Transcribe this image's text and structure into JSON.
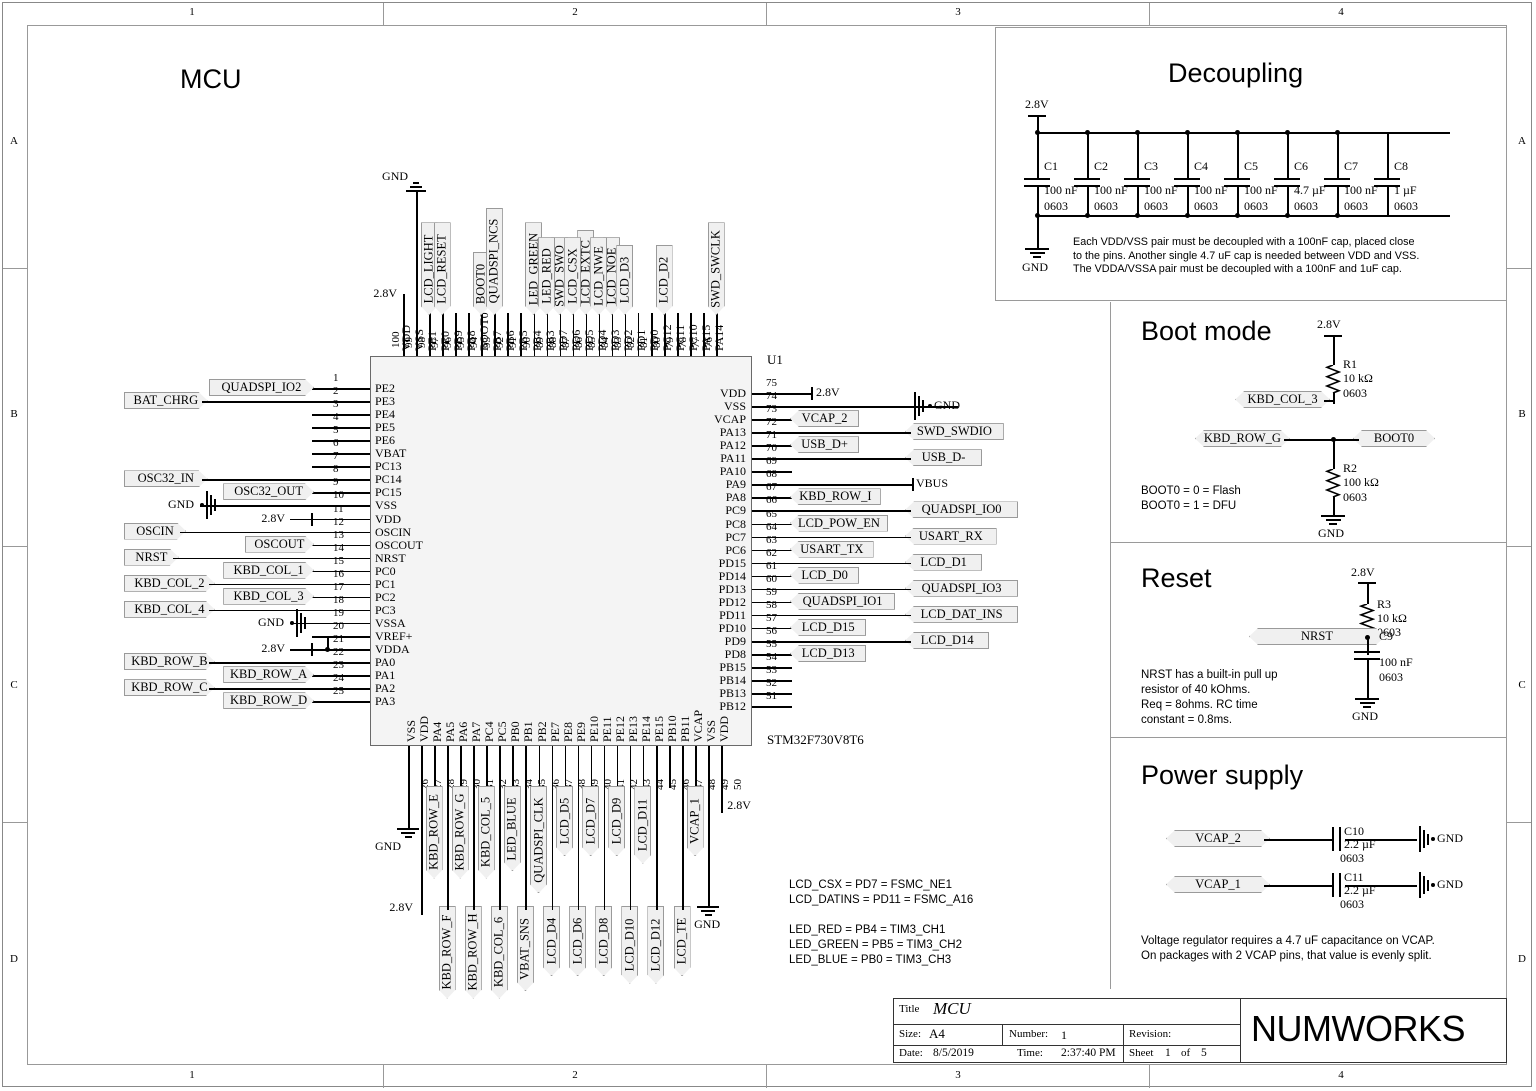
{
  "sheet": {
    "zones_top": [
      "1",
      "2",
      "3",
      "4"
    ],
    "zones_bottom": [
      "1",
      "2",
      "3",
      "4"
    ],
    "zones_left": [
      "A",
      "B",
      "C",
      "D"
    ],
    "zones_right": [
      "A",
      "B",
      "C",
      "D"
    ]
  },
  "titles": {
    "mcu": "MCU",
    "decoupling": "Decoupling",
    "boot_mode": "Boot mode",
    "reset": "Reset",
    "power_supply": "Power supply"
  },
  "chip": {
    "refdes": "U1",
    "part_number": "STM32F730V8T6",
    "left_pins": [
      {
        "num": "1",
        "name": "PE2"
      },
      {
        "num": "2",
        "name": "PE3"
      },
      {
        "num": "3",
        "name": "PE4"
      },
      {
        "num": "4",
        "name": "PE5"
      },
      {
        "num": "5",
        "name": "PE6"
      },
      {
        "num": "6",
        "name": "VBAT"
      },
      {
        "num": "7",
        "name": "PC13"
      },
      {
        "num": "8",
        "name": "PC14"
      },
      {
        "num": "9",
        "name": "PC15"
      },
      {
        "num": "10",
        "name": "VSS"
      },
      {
        "num": "11",
        "name": "VDD"
      },
      {
        "num": "12",
        "name": "OSCIN"
      },
      {
        "num": "13",
        "name": "OSCOUT"
      },
      {
        "num": "14",
        "name": "NRST"
      },
      {
        "num": "15",
        "name": "PC0"
      },
      {
        "num": "16",
        "name": "PC1"
      },
      {
        "num": "17",
        "name": "PC2"
      },
      {
        "num": "18",
        "name": "PC3"
      },
      {
        "num": "19",
        "name": "VSSA"
      },
      {
        "num": "20",
        "name": "VREF+"
      },
      {
        "num": "21",
        "name": "VDDA"
      },
      {
        "num": "22",
        "name": "PA0"
      },
      {
        "num": "23",
        "name": "PA1"
      },
      {
        "num": "24",
        "name": "PA2"
      },
      {
        "num": "25",
        "name": "PA3"
      }
    ],
    "bottom_pins": [
      {
        "num": "26",
        "name": "VSS"
      },
      {
        "num": "27",
        "name": "VDD"
      },
      {
        "num": "28",
        "name": "PA4"
      },
      {
        "num": "29",
        "name": "PA5"
      },
      {
        "num": "30",
        "name": "PA6"
      },
      {
        "num": "31",
        "name": "PA7"
      },
      {
        "num": "32",
        "name": "PC4"
      },
      {
        "num": "33",
        "name": "PC5"
      },
      {
        "num": "34",
        "name": "PB0"
      },
      {
        "num": "35",
        "name": "PB1"
      },
      {
        "num": "36",
        "name": "PB2"
      },
      {
        "num": "37",
        "name": "PE7"
      },
      {
        "num": "38",
        "name": "PE8"
      },
      {
        "num": "39",
        "name": "PE9"
      },
      {
        "num": "40",
        "name": "PE10"
      },
      {
        "num": "41",
        "name": "PE11"
      },
      {
        "num": "42",
        "name": "PE12"
      },
      {
        "num": "43",
        "name": "PE13"
      },
      {
        "num": "44",
        "name": "PE14"
      },
      {
        "num": "45",
        "name": "PE15"
      },
      {
        "num": "46",
        "name": "PB10"
      },
      {
        "num": "47",
        "name": "PB11"
      },
      {
        "num": "48",
        "name": "VCAP"
      },
      {
        "num": "49",
        "name": "VSS"
      },
      {
        "num": "50",
        "name": "VDD"
      }
    ],
    "right_pins": [
      {
        "num": "75",
        "name": "VDD"
      },
      {
        "num": "74",
        "name": "VSS"
      },
      {
        "num": "73",
        "name": "VCAP"
      },
      {
        "num": "72",
        "name": "PA13"
      },
      {
        "num": "71",
        "name": "PA12"
      },
      {
        "num": "70",
        "name": "PA11"
      },
      {
        "num": "69",
        "name": "PA10"
      },
      {
        "num": "68",
        "name": "PA9"
      },
      {
        "num": "67",
        "name": "PA8"
      },
      {
        "num": "66",
        "name": "PC9"
      },
      {
        "num": "65",
        "name": "PC8"
      },
      {
        "num": "64",
        "name": "PC7"
      },
      {
        "num": "63",
        "name": "PC6"
      },
      {
        "num": "62",
        "name": "PD15"
      },
      {
        "num": "61",
        "name": "PD14"
      },
      {
        "num": "60",
        "name": "PD13"
      },
      {
        "num": "59",
        "name": "PD12"
      },
      {
        "num": "58",
        "name": "PD11"
      },
      {
        "num": "57",
        "name": "PD10"
      },
      {
        "num": "56",
        "name": "PD9"
      },
      {
        "num": "55",
        "name": "PD8"
      },
      {
        "num": "54",
        "name": "PB15"
      },
      {
        "num": "53",
        "name": "PB14"
      },
      {
        "num": "52",
        "name": "PB13"
      },
      {
        "num": "51",
        "name": "PB12"
      }
    ],
    "top_pins": [
      {
        "num": "100",
        "name": "VDD"
      },
      {
        "num": "99",
        "name": "VSS"
      },
      {
        "num": "98",
        "name": "PE1"
      },
      {
        "num": "97",
        "name": "PE0"
      },
      {
        "num": "96",
        "name": "PB9"
      },
      {
        "num": "95",
        "name": "PB8"
      },
      {
        "num": "94",
        "name": "BOOT0"
      },
      {
        "num": "93",
        "name": "PB7"
      },
      {
        "num": "92",
        "name": "PB6"
      },
      {
        "num": "91",
        "name": "PB5"
      },
      {
        "num": "90",
        "name": "PB4"
      },
      {
        "num": "89",
        "name": "PB3"
      },
      {
        "num": "88",
        "name": "PD7"
      },
      {
        "num": "87",
        "name": "PD6"
      },
      {
        "num": "86",
        "name": "PD5"
      },
      {
        "num": "85",
        "name": "PD4"
      },
      {
        "num": "84",
        "name": "PD3"
      },
      {
        "num": "83",
        "name": "PD2"
      },
      {
        "num": "82",
        "name": "PD1"
      },
      {
        "num": "81",
        "name": "PD0"
      },
      {
        "num": "80",
        "name": "PC12"
      },
      {
        "num": "79",
        "name": "PC11"
      },
      {
        "num": "78",
        "name": "PC10"
      },
      {
        "num": "77",
        "name": "PA15"
      },
      {
        "num": "76",
        "name": "PA14"
      }
    ]
  },
  "nets": {
    "left_far": [
      "BAT_CHRG",
      "OSC32_IN",
      "OSCIN",
      "NRST",
      "KBD_COL_2",
      "KBD_COL_4",
      "KBD_ROW_B",
      "KBD_ROW_C"
    ],
    "left_near": [
      "QUADSPI_IO2",
      "OSC32_OUT",
      "OSCOUT",
      "KBD_COL_1",
      "KBD_COL_3",
      "KBD_ROW_A",
      "KBD_ROW_D"
    ],
    "left_power": [
      "GND",
      "2.8V",
      "GND",
      "2.8V"
    ],
    "right_near": [
      "VCAP_2",
      "USB_D+",
      "KBD_ROW_I",
      "LCD_POW_EN",
      "USART_TX",
      "LCD_D0",
      "QUADSPI_IO1",
      "LCD_D15",
      "LCD_D13"
    ],
    "right_far": [
      "SWD_SWDIO",
      "USB_D-",
      "QUADSPI_IO0",
      "USART_RX",
      "LCD_D1",
      "QUADSPI_IO3",
      "LCD_DAT_INS",
      "LCD_D14"
    ],
    "right_power": [
      "2.8V",
      "GND",
      "VBUS"
    ],
    "top_upper": [
      "LCD_LIGHT",
      "LED_GREEN",
      "SWD_SWO",
      "LCD_EXTC",
      "LCD_NOE",
      "LCD_D2"
    ],
    "top_lower": [
      "LCD_RESET",
      "BOOT0",
      "QUADSPI_NCS",
      "LED_RED",
      "LCD_CSX",
      "LCD_NWE",
      "LCD_D3",
      "SWD_SWCLK"
    ],
    "top_power": [
      "GND",
      "2.8V"
    ],
    "bottom_upper": [
      "KBD_ROW_E",
      "KBD_ROW_G",
      "KBD_COL_5",
      "LED_BLUE",
      "QUADSPI_CLK",
      "LCD_D5",
      "LCD_D7",
      "LCD_D9",
      "LCD_D11",
      "VCAP_1"
    ],
    "bottom_lower": [
      "KBD_ROW_F",
      "KBD_ROW_H",
      "KBD_COL_6",
      "VBAT_SNS",
      "LCD_D4",
      "LCD_D6",
      "LCD_D8",
      "LCD_D10",
      "LCD_D12",
      "LCD_TE"
    ],
    "bottom_power": [
      "GND",
      "2.8V",
      "2.8V",
      "GND"
    ]
  },
  "decoupling": {
    "rail": "2.8V",
    "gnd": "GND",
    "caps": [
      {
        "ref": "C1",
        "value": "100 nF",
        "pkg": "0603"
      },
      {
        "ref": "C2",
        "value": "100 nF",
        "pkg": "0603"
      },
      {
        "ref": "C3",
        "value": "100 nF",
        "pkg": "0603"
      },
      {
        "ref": "C4",
        "value": "100 nF",
        "pkg": "0603"
      },
      {
        "ref": "C5",
        "value": "100 nF",
        "pkg": "0603"
      },
      {
        "ref": "C6",
        "value": "4.7 µF",
        "pkg": "0603"
      },
      {
        "ref": "C7",
        "value": "100 nF",
        "pkg": "0603"
      },
      {
        "ref": "C8",
        "value": "1 µF",
        "pkg": "0603"
      }
    ],
    "note": [
      "Each VDD/VSS pair must be decoupled with a 100nF cap, placed close",
      "to the pins. Another single 4.7 uF cap is needed between VDD and VSS.",
      "The VDDA/VSSA pair must be decoupled with a 100nF and 1uF cap."
    ]
  },
  "boot_mode": {
    "rail": "2.8V",
    "gnd": "GND",
    "r1": {
      "ref": "R1",
      "value": "10 kΩ",
      "pkg": "0603"
    },
    "r2": {
      "ref": "R2",
      "value": "100 kΩ",
      "pkg": "0603"
    },
    "net_col3": "KBD_COL_3",
    "net_rowg": "KBD_ROW_G",
    "net_boot0": "BOOT0",
    "note": [
      "BOOT0 = 0 = Flash",
      "BOOT0 = 1 = DFU"
    ]
  },
  "reset": {
    "rail": "2.8V",
    "gnd": "GND",
    "r3": {
      "ref": "R3",
      "value": "10 kΩ",
      "pkg": "0603"
    },
    "c9": {
      "ref": "C9",
      "value": "100 nF",
      "pkg": "0603"
    },
    "net_nrst": "NRST",
    "note": [
      "NRST has a built-in pull up",
      "resistor of 40 kOhms.",
      "Req = 8ohms. RC time",
      "constant = 0.8ms."
    ]
  },
  "power_supply": {
    "rows": [
      {
        "net": "VCAP_2",
        "ref": "C10",
        "value": "2.2 µF",
        "pkg": "0603",
        "gnd": "GND"
      },
      {
        "net": "VCAP_1",
        "ref": "C11",
        "value": "2.2 µF",
        "pkg": "0603",
        "gnd": "GND"
      }
    ],
    "note": [
      "Voltage regulator requires a 4.7 uF capacitance on VCAP.",
      "On packages with 2 VCAP pins, that value is evenly split."
    ]
  },
  "pin_notes": [
    "LCD_CSX = PD7 = FSMC_NE1",
    "LCD_DATINS = PD11 = FSMC_A16",
    "",
    "LED_RED = PB4 = TIM3_CH1",
    "LED_GREEN = PB5 = TIM3_CH2",
    "LED_BLUE = PB0 = TIM3_CH3"
  ],
  "title_block": {
    "title_label": "Title",
    "title_value": "MCU",
    "size_label": "Size:",
    "size_value": "A4",
    "number_label": "Number:",
    "number_value": "1",
    "revision_label": "Revision:",
    "revision_value": "",
    "date_label": "Date:",
    "date_value": "8/5/2019",
    "time_label": "Time:",
    "time_value": "2:37:40 PM",
    "sheet_label": "Sheet",
    "sheet_value": "1",
    "sheet_of_label": "of",
    "sheet_total": "5",
    "company": "NUMWORKS"
  }
}
